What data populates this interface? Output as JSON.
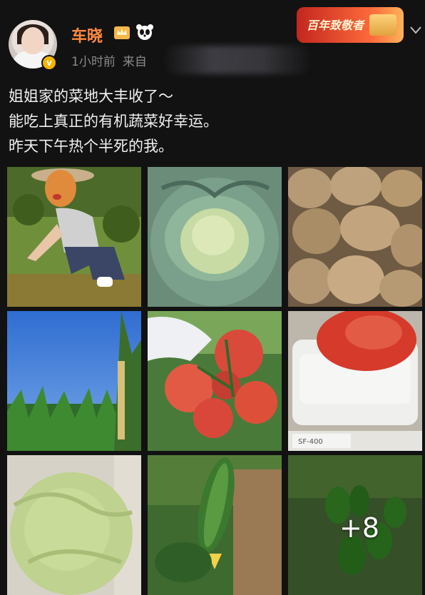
{
  "post": {
    "username": "车晓",
    "time": "1小时前",
    "source_prefix": "来自",
    "text_lines": [
      "姐姐家的菜地大丰收了～",
      "能吃上真正的有机蔬菜好幸运。",
      "昨天下午热个半死的我。"
    ]
  },
  "promo": {
    "label": "百年致敬者"
  },
  "icons": {
    "verified": "verified-badge-icon",
    "crown": "crown-icon",
    "panda": "panda-icon",
    "more": "chevron-down-icon"
  },
  "photos": [
    {
      "name": "photo-woman-in-garden"
    },
    {
      "name": "photo-cabbage"
    },
    {
      "name": "photo-potatoes"
    },
    {
      "name": "photo-corn-field"
    },
    {
      "name": "photo-tomatoes-on-vine"
    },
    {
      "name": "photo-tomato-on-scale",
      "scale_label": "SF-400"
    },
    {
      "name": "photo-cabbage-closeup"
    },
    {
      "name": "photo-cucumber"
    },
    {
      "name": "photo-peppers",
      "more_count": "+8"
    }
  ],
  "colors": {
    "background": "#121212",
    "username": "#ff8a3d",
    "meta": "#8a8a8a"
  }
}
